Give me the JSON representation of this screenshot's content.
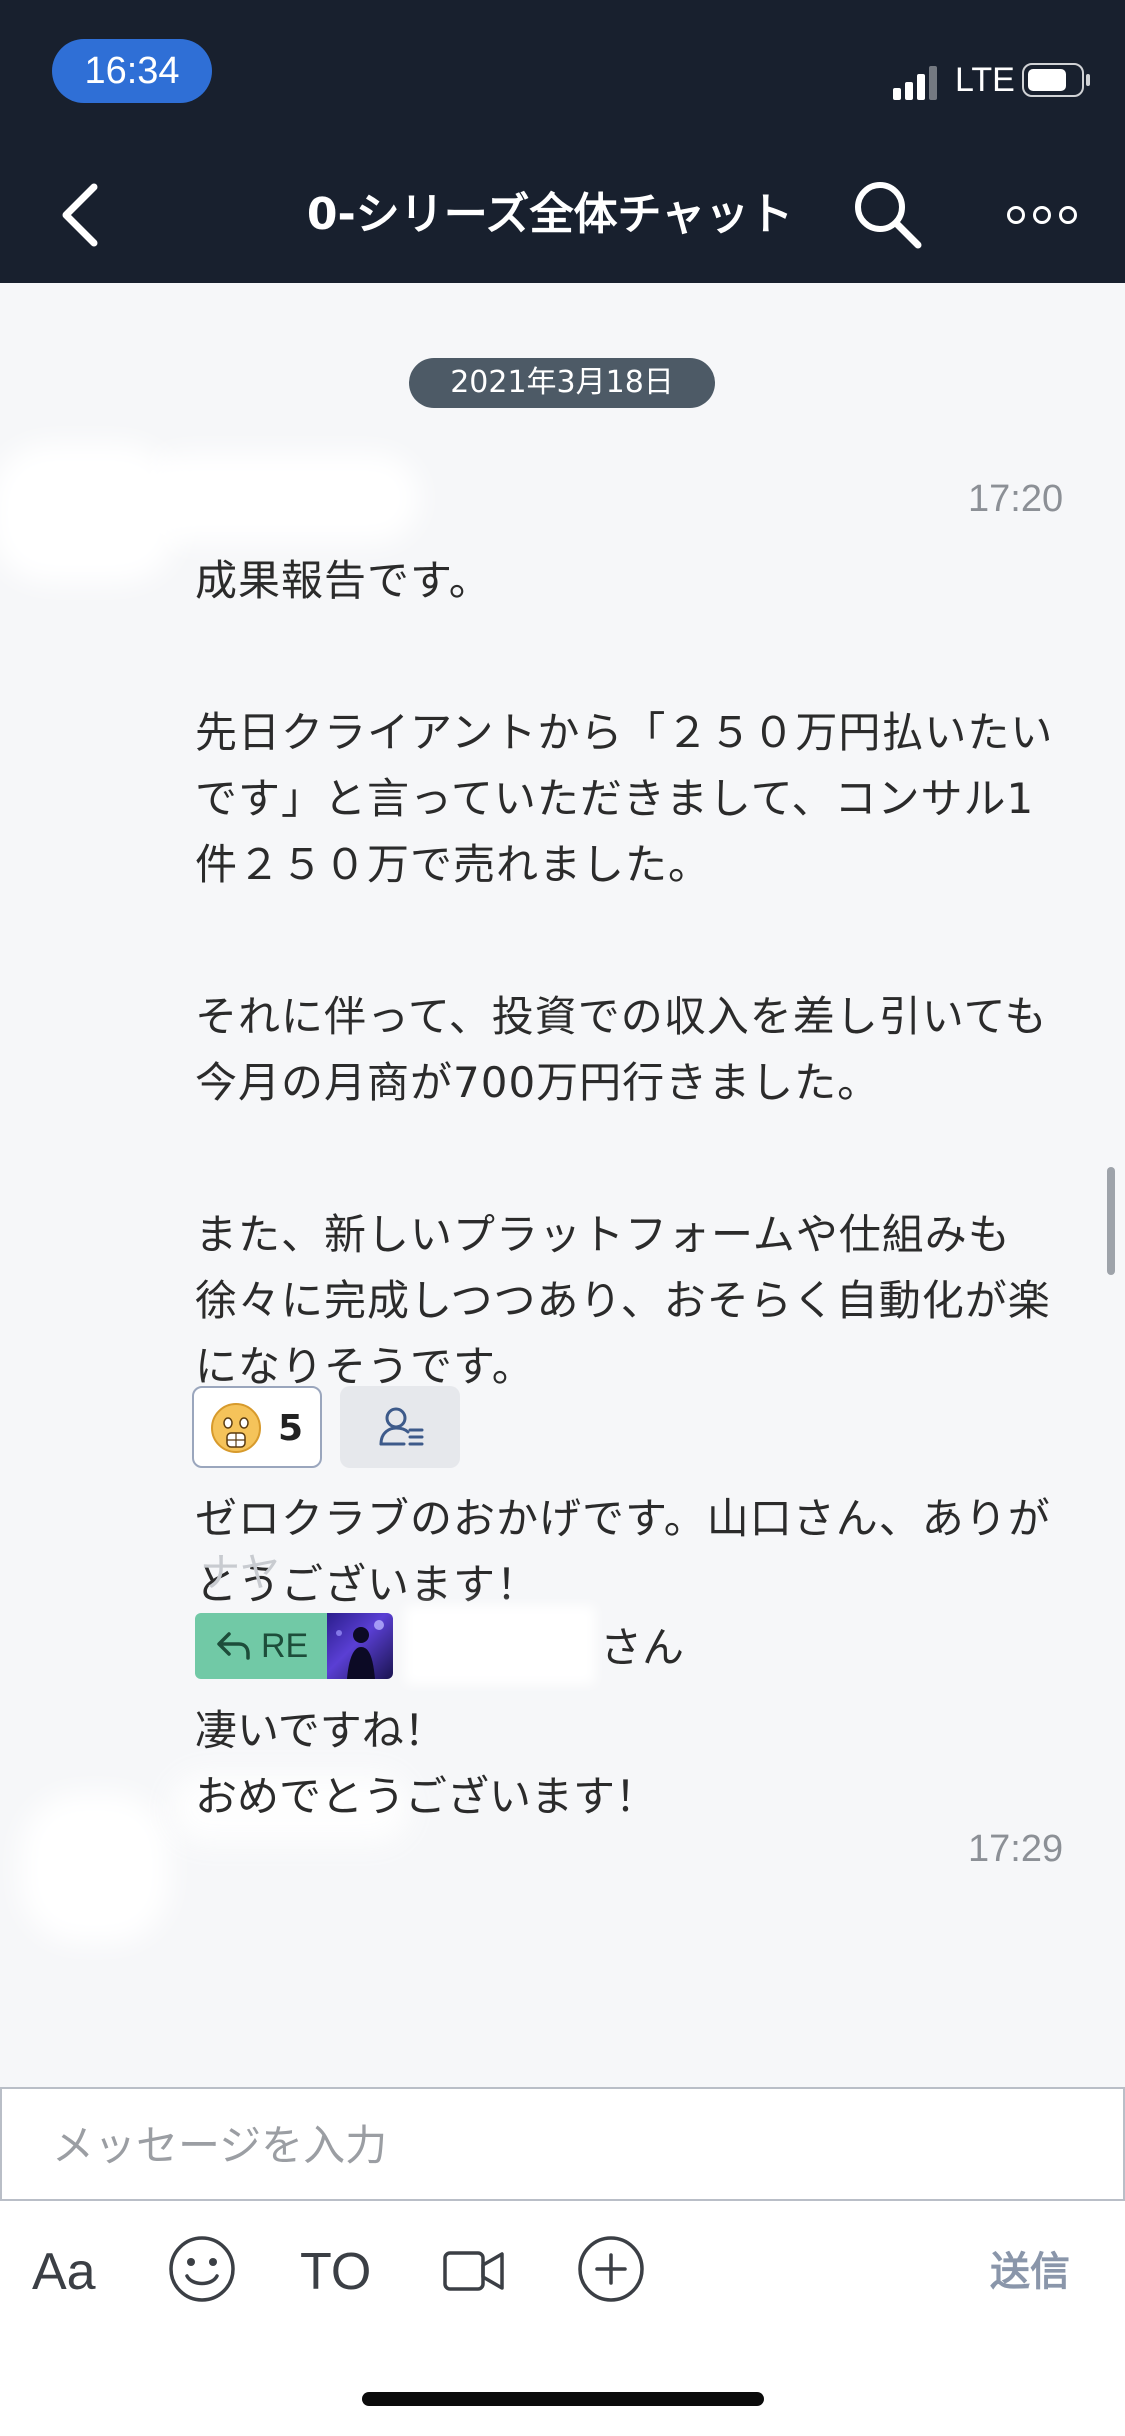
{
  "status_bar": {
    "time": "16:34",
    "network": "LTE"
  },
  "header": {
    "title": "0-シリーズ全体チャット"
  },
  "chat": {
    "date": "2021年3月18日",
    "messages": [
      {
        "time": "17:20",
        "paragraphs": [
          "成果報告です。",
          "先日クライアントから「２５０万円払いたいです」と言っていただきまして、コンサル1件２５０万で売れました。",
          "それに伴って、投資での収入を差し引いても今月の月商が700万円行きました。",
          "また、新しいプラットフォームや仕組みも徐々に完成しつつあり、おそらく自動化が楽になりそうです。",
          "ゼロクラブのおかげです。山口さん、ありがとうございます！"
        ],
        "reaction_count": "5"
      },
      {
        "sender": "ナヤ",
        "time": "17:29",
        "reply_tag": "RE",
        "reply_to_suffix": "さん",
        "lines": [
          "凄いですね！",
          "おめでとうございます！"
        ]
      }
    ]
  },
  "composer": {
    "placeholder": "メッセージを入力",
    "font_tool": "Aa",
    "to_tool": "TO",
    "send_label": "送信"
  },
  "icons": {
    "back": "chevron-left-icon",
    "search": "search-icon",
    "more": "more-icon",
    "emoji": "smiley-icon",
    "video": "video-icon",
    "plus": "plus-circle-icon",
    "reaction": "surprised-face-icon",
    "readers": "read-list-icon"
  },
  "colors": {
    "header_bg": "#18202e",
    "time_pill": "#2f6fd6",
    "re_tag": "#71c9a6",
    "send": "#8a96aa"
  }
}
